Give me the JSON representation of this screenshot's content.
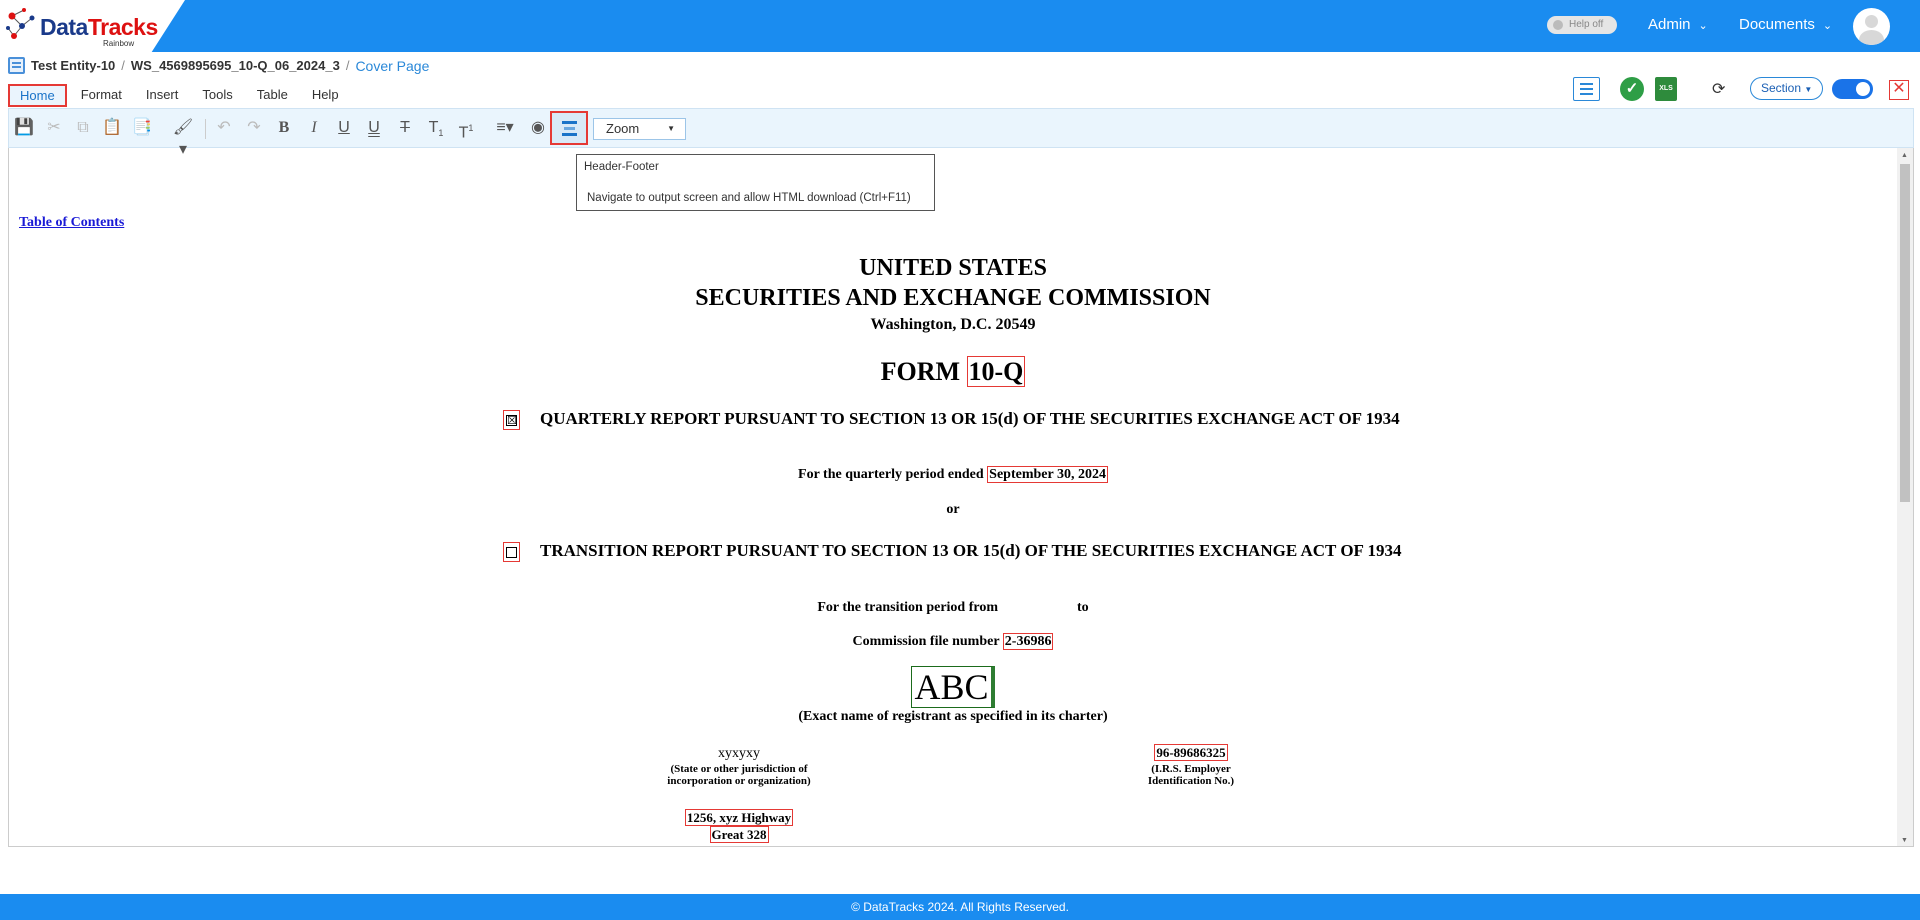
{
  "brand": {
    "name_dark": "Data",
    "name_red": "Tracks",
    "sub": "Rainbow"
  },
  "header": {
    "help_toggle": "Help off",
    "admin_label": "Admin",
    "documents_label": "Documents"
  },
  "breadcrumb": {
    "entity": "Test Entity-10",
    "workspace": "WS_4569895695_10-Q_06_2024_3",
    "page": "Cover Page"
  },
  "menu": [
    "Home",
    "Format",
    "Insert",
    "Tools",
    "Table",
    "Help"
  ],
  "right_toolbar": {
    "section_label": "Section",
    "xls_label": "XLS"
  },
  "zoom": {
    "label": "Zoom"
  },
  "tooltip": {
    "title": "Header-Footer",
    "description": "Navigate to output screen and allow HTML download (Ctrl+F11)"
  },
  "document": {
    "toc_link": "Table of Contents",
    "line1": "UNITED STATES",
    "line2": "SECURITIES AND EXCHANGE COMMISSION",
    "line3": "Washington, D.C. 20549",
    "form_label": "FORM",
    "form_type": "10-Q",
    "quarterly_checked": "☒",
    "quarterly_report": "QUARTERLY REPORT PURSUANT TO SECTION 13 OR 15(d) OF THE SECURITIES EXCHANGE ACT OF 1934",
    "period_label": "For the quarterly period ended",
    "period_value": "September 30, 2024",
    "or": "or",
    "transition_unchecked": "☐",
    "transition_report": "TRANSITION REPORT PURSUANT TO SECTION 13 OR 15(d) OF THE SECURITIES EXCHANGE ACT OF 1934",
    "transition_from": "For the transition period from",
    "transition_to": "to",
    "commission_label": "Commission file number",
    "commission_value": "2-36986",
    "registrant": "ABC",
    "registrant_caption": "(Exact name of registrant as specified in its charter)",
    "state_value": "xyxyxy",
    "state_caption_1": "(State or other jurisdiction of",
    "state_caption_2": "incorporation or organization)",
    "irs_value": "96-89686325",
    "irs_caption_1": "(I.R.S. Employer",
    "irs_caption_2": "Identification No.)",
    "address_1": "1256, xyz Highway",
    "address_2": "Great 328"
  },
  "footer": {
    "text": "© DataTracks 2024. All Rights Reserved."
  },
  "colors": {
    "brand_blue": "#1a8cf0",
    "highlight_red": "#e53935",
    "link_blue": "#1a1ad6"
  }
}
